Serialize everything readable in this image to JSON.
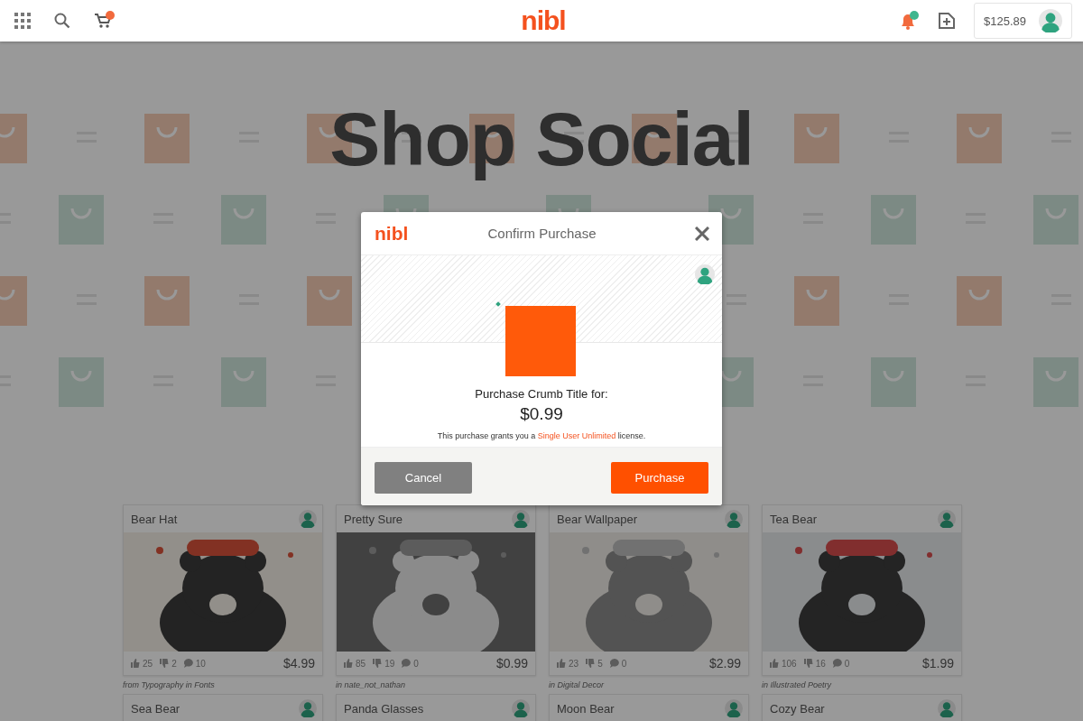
{
  "header": {
    "logo": "nibl",
    "balance": "$125.89"
  },
  "hero": {
    "title": "Shop Social"
  },
  "cards": [
    {
      "title": "Bear Hat",
      "likes": "25",
      "dislikes": "2",
      "comments": "10",
      "price": "$4.99",
      "caption": "from Typography in Fonts"
    },
    {
      "title": "Pretty Sure",
      "likes": "85",
      "dislikes": "19",
      "comments": "0",
      "price": "$0.99",
      "caption": "in nate_not_nathan"
    },
    {
      "title": "Bear Wallpaper",
      "likes": "23",
      "dislikes": "5",
      "comments": "0",
      "price": "$2.99",
      "caption": "in Digital Decor"
    },
    {
      "title": "Tea Bear",
      "likes": "106",
      "dislikes": "16",
      "comments": "0",
      "price": "$1.99",
      "caption": "in Illustrated Poetry"
    },
    {
      "title": "Sea Bear"
    },
    {
      "title": "Panda Glasses"
    },
    {
      "title": "Moon Bear"
    },
    {
      "title": "Cozy Bear"
    }
  ],
  "modal": {
    "logo": "nibl",
    "title": "Confirm Purchase",
    "prompt": "Purchase Crumb Title for:",
    "price": "$0.99",
    "license_before": "This purchase grants you a",
    "license_link": "Single User Unlimited",
    "license_after": "license.",
    "buttons": [
      {
        "label": "Cancel",
        "kind": "secondary"
      },
      {
        "label": "Purchase",
        "kind": "primary"
      }
    ]
  }
}
